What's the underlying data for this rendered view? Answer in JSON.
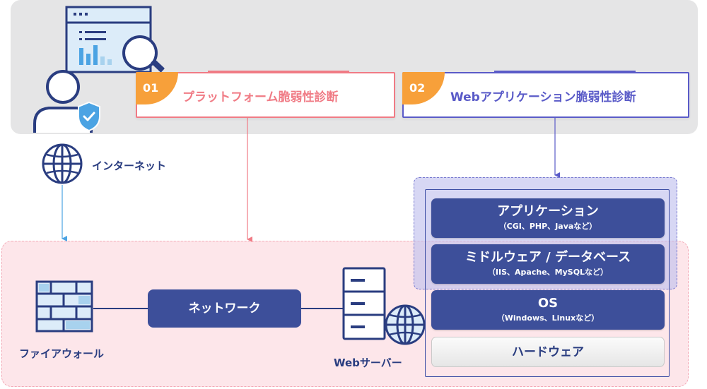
{
  "top": {
    "card1": {
      "number": "01",
      "title": "プラットフォーム脆弱性診断"
    },
    "card2": {
      "number": "02",
      "title": "Webアプリケーション脆弱性診断"
    }
  },
  "labels": {
    "internet": "インターネット",
    "firewall": "ファイアウォール",
    "network": "ネットワーク",
    "web_server": "Webサーバー"
  },
  "stack": [
    {
      "title": "アプリケーション",
      "sub": "（CGI、PHP、Javaなど）"
    },
    {
      "title": "ミドルウェア / データベース",
      "sub": "（IIS、Apache、MySQLなど）"
    },
    {
      "title": "OS",
      "sub": "（Windows、Linuxなど）"
    },
    {
      "title": "ハードウェア"
    }
  ],
  "colors": {
    "platform": "#f07b85",
    "webapp": "#5a5bc8",
    "navy": "#2a3d80",
    "layer": "#3d4f9a",
    "badge_orange": "#f7a03a",
    "internet_arrow": "#4ba3e3"
  },
  "icons": [
    "user-icon",
    "shield-check-icon",
    "browser-analytics-icon",
    "magnifier-icon",
    "globe-icon",
    "firewall-icon",
    "server-icon"
  ]
}
